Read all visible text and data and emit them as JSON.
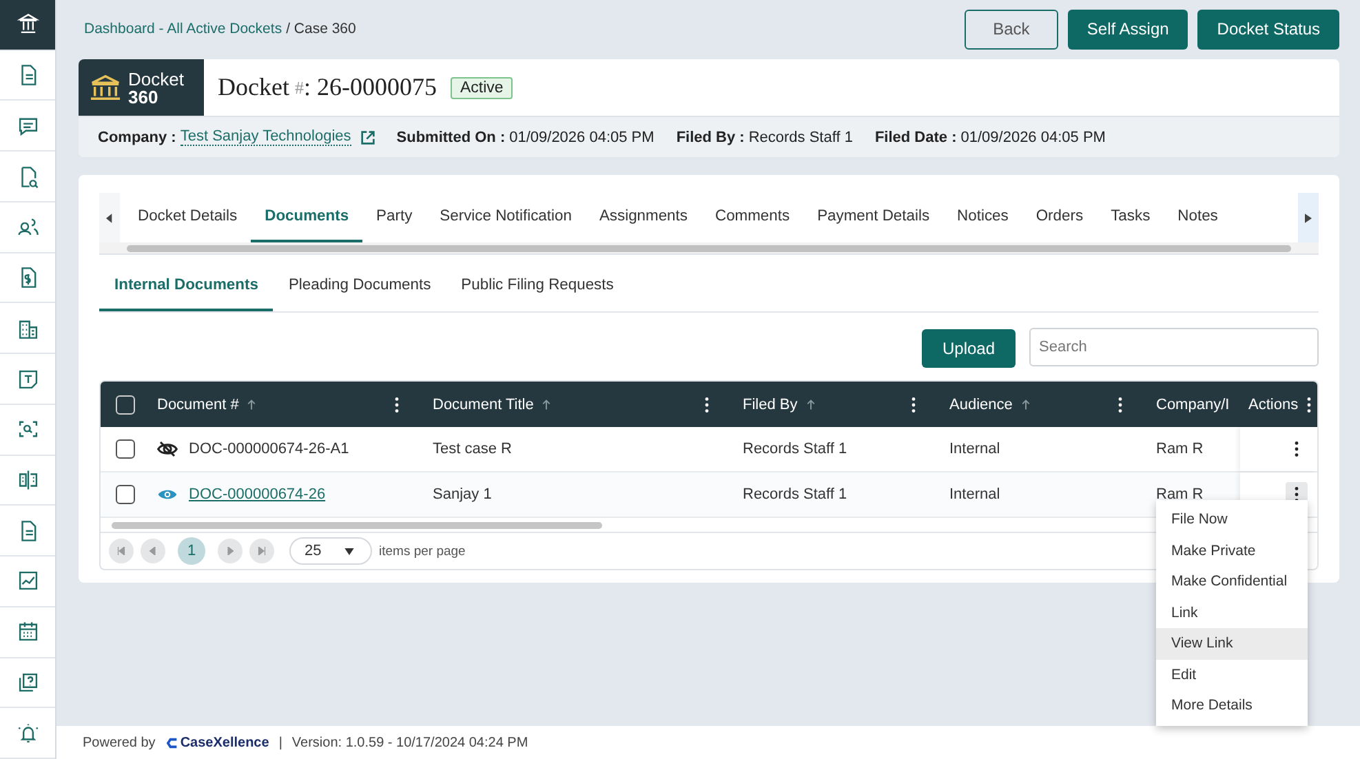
{
  "sidebar": {
    "items": [
      {
        "selected": true
      },
      {
        "selected": false
      },
      {
        "selected": false
      },
      {
        "selected": false
      },
      {
        "selected": false
      },
      {
        "selected": false
      },
      {
        "selected": false
      },
      {
        "selected": false
      },
      {
        "selected": false
      },
      {
        "selected": false
      },
      {
        "selected": false
      },
      {
        "selected": false
      },
      {
        "selected": false
      },
      {
        "selected": false
      },
      {
        "selected": false
      }
    ]
  },
  "breadcrumb": {
    "link": "Dashboard - All Active Dockets",
    "current": "/ Case 360"
  },
  "header_buttons": [
    {
      "label": "Back",
      "kind": "outline"
    },
    {
      "label": "Self Assign",
      "kind": "filled"
    },
    {
      "label": "Docket Status",
      "kind": "filled"
    }
  ],
  "docket": {
    "logo_label": "Docket",
    "logo_number": "360",
    "title": "Docket",
    "title_mark": "#",
    "number": ": 26-0000075",
    "status": "Active"
  },
  "info": [
    {
      "label": "Company :",
      "value": "Test Sanjay Technologies",
      "kind": "link"
    },
    {
      "label": "Submitted On :",
      "value": "01/09/2026 04:05 PM",
      "kind": "text"
    },
    {
      "label": "Filed By :",
      "value": "Records Staff 1",
      "kind": "text"
    },
    {
      "label": "Filed Date :",
      "value": "01/09/2026 04:05 PM",
      "kind": "text"
    }
  ],
  "tabs": [
    {
      "label": "Docket Details",
      "selected": false
    },
    {
      "label": "Documents",
      "selected": true
    },
    {
      "label": "Party",
      "selected": false
    },
    {
      "label": "Service Notification",
      "selected": false
    },
    {
      "label": "Assignments",
      "selected": false
    },
    {
      "label": "Comments",
      "selected": false
    },
    {
      "label": "Payment Details",
      "selected": false
    },
    {
      "label": "Notices",
      "selected": false
    },
    {
      "label": "Orders",
      "selected": false
    },
    {
      "label": "Tasks",
      "selected": false
    },
    {
      "label": "Notes",
      "selected": false
    }
  ],
  "sub_tabs": [
    {
      "label": "Internal Documents",
      "selected": true
    },
    {
      "label": "Pleading Documents",
      "selected": false
    },
    {
      "label": "Public Filing Requests",
      "selected": false
    }
  ],
  "upload_button": "Upload",
  "search": {
    "placeholder": "Search"
  },
  "table": {
    "select_all_checked": false,
    "columns": [
      {
        "label": "Document #",
        "sortable": true
      },
      {
        "label": "Document Title",
        "sortable": true
      },
      {
        "label": "Filed By",
        "sortable": true
      },
      {
        "label": "Audience",
        "sortable": true
      },
      {
        "label": "Company/I",
        "sortable": false
      },
      {
        "label": "Actions",
        "sortable": false
      }
    ],
    "rows": [
      {
        "checked": false,
        "hidden": true,
        "document": "DOC-000000674-26-A1",
        "linked": false,
        "title": "Test case R",
        "filed_by": "Records Staff 1",
        "audience": "Internal",
        "company": "Ram R",
        "menu_open": false
      },
      {
        "checked": false,
        "hidden": false,
        "document": "DOC-000000674-26",
        "linked": true,
        "title": "Sanjay 1",
        "filed_by": "Records Staff 1",
        "audience": "Internal",
        "company": "Ram R",
        "menu_open": true
      }
    ]
  },
  "pagination": {
    "page": "1",
    "page_size": "25",
    "label": "items per page"
  },
  "action_menu": [
    {
      "label": "File Now",
      "selected": false
    },
    {
      "label": "Make Private",
      "selected": false
    },
    {
      "label": "Make Confidential",
      "selected": false
    },
    {
      "label": "Link",
      "selected": false
    },
    {
      "label": "View Link",
      "selected": true
    },
    {
      "label": "Edit",
      "selected": false
    },
    {
      "label": "More Details",
      "selected": false
    }
  ],
  "footer": {
    "powered_by": "Powered by",
    "brand": "CaseXellence",
    "separator": "|",
    "version": "Version: 1.0.59 - 10/17/2024 04:24 PM"
  }
}
